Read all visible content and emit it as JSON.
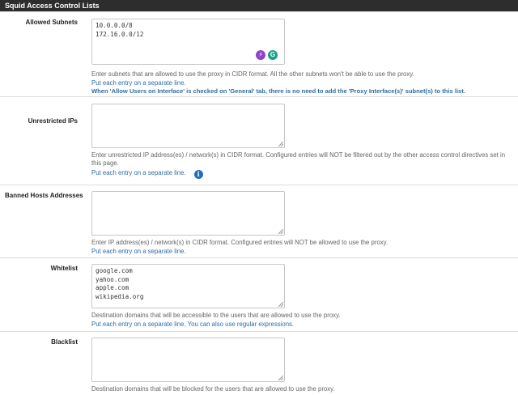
{
  "section_title": "Squid Access Control Lists",
  "allowed_subnets": {
    "label": "Allowed Subnets",
    "value": "10.0.0.0/8\n172.16.0.0/12",
    "help": "Enter subnets that are allowed to use the proxy in CIDR format. All the other subnets won't be able to use the proxy.",
    "note1": "Put each entry on a separate line.",
    "note2": "When 'Allow Users on Interface' is checked on 'General' tab, there is no need to add the 'Proxy Interface(s)' subnet(s) to this list."
  },
  "unrestricted_ips": {
    "label": "Unrestricted IPs",
    "value": "",
    "help": "Enter unrestricted IP address(es) / network(s) in CIDR format. Configured entries will NOT be filtered out by the other access control directives set in this page.",
    "note1": "Put each entry on a separate line."
  },
  "banned_hosts": {
    "label": "Banned Hosts Addresses",
    "value": "",
    "help": "Enter IP address(es) / network(s) in CIDR format. Configured entries will NOT be allowed to use the proxy.",
    "note1": "Put each entry on a separate line."
  },
  "whitelist": {
    "label": "Whitelist",
    "value": "google.com\nyahoo.com\napple.com\nwikipedia.org",
    "help": "Destination domains that will be accessible to the users that are allowed to use the proxy.",
    "note1": "Put each entry on a separate line. You can also use regular expressions."
  },
  "blacklist": {
    "label": "Blacklist",
    "value": "",
    "help": "Destination domains that will be blocked for the users that are allowed to use the proxy."
  },
  "icons": {
    "extension_badge_1": "lightning-icon",
    "extension_badge_2": "grammarly-icon",
    "info": "info-icon"
  },
  "colors": {
    "header_bg": "#2d2d2d",
    "link_blue": "#2f6da3",
    "badge_purple": "#8e44c9",
    "badge_teal": "#15a18a",
    "info_blue": "#1f6fb8"
  }
}
